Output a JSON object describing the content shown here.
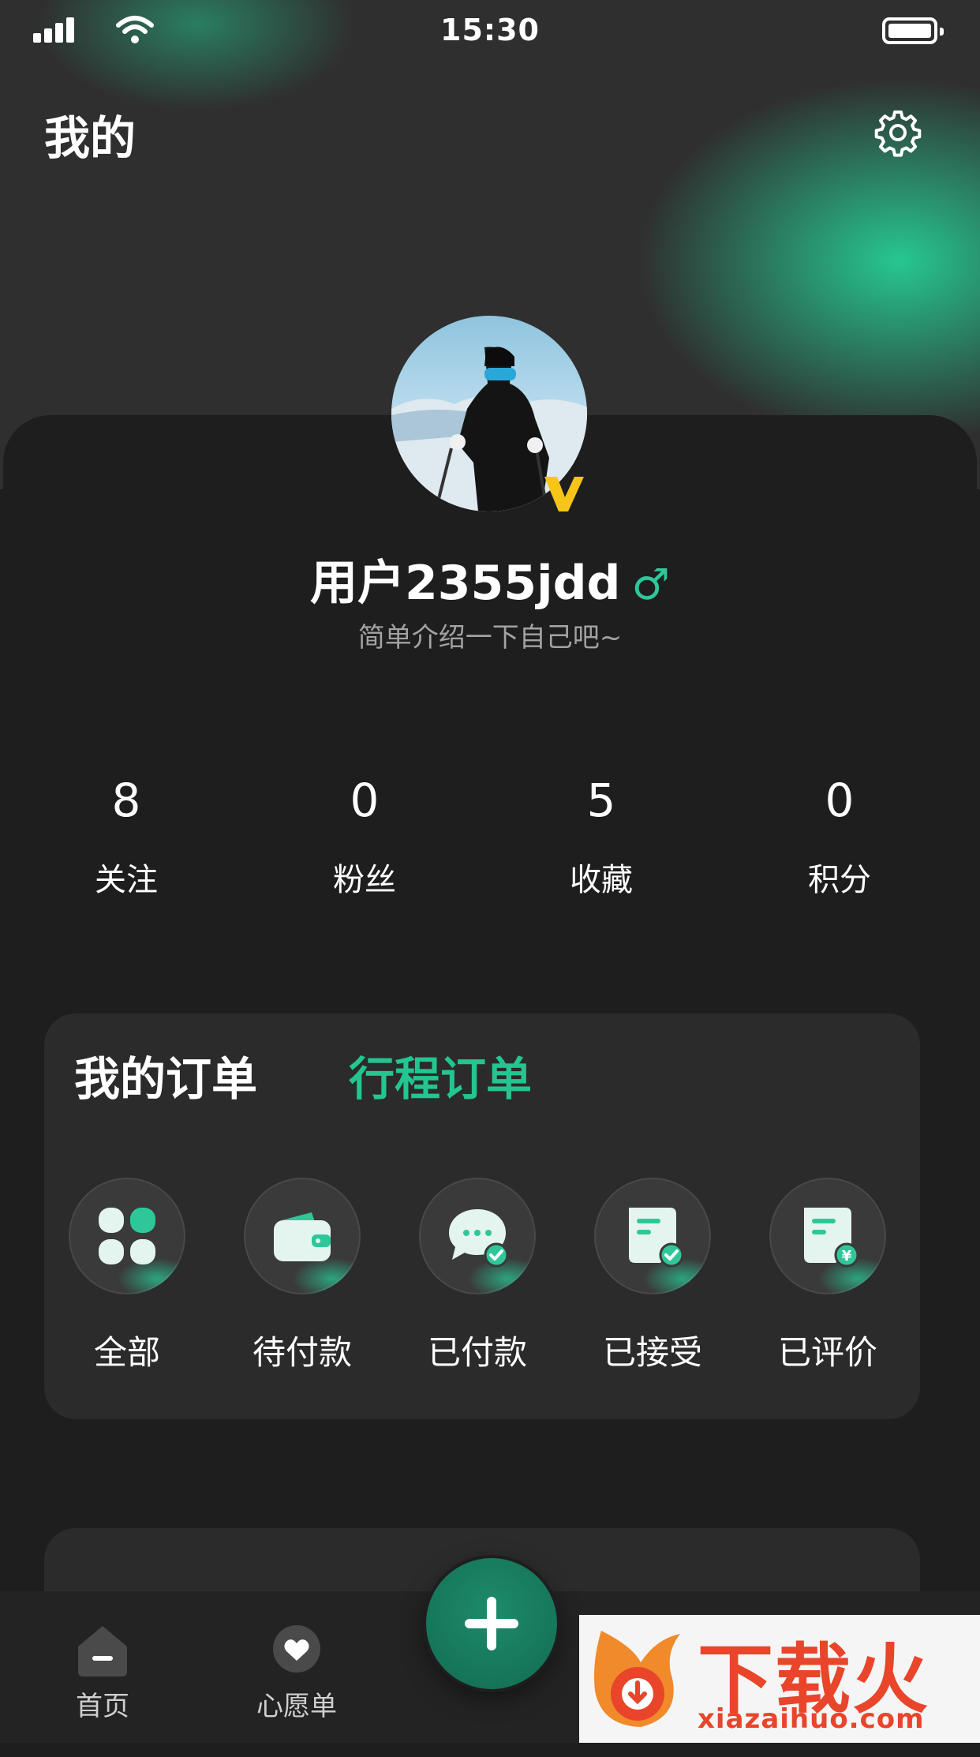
{
  "status_bar": {
    "time": "15:30"
  },
  "header": {
    "title": "我的"
  },
  "profile": {
    "username": "用户2355jdd",
    "gender_symbol": "♂",
    "bio": "简单介绍一下自己吧~"
  },
  "stats": [
    {
      "value": "8",
      "label": "关注"
    },
    {
      "value": "0",
      "label": "粉丝"
    },
    {
      "value": "5",
      "label": "收藏"
    },
    {
      "value": "0",
      "label": "积分"
    }
  ],
  "orders": {
    "tabs": [
      "我的订单",
      "行程订单"
    ],
    "active_tab": "行程订单",
    "items": [
      {
        "label": "全部",
        "icon": "grid-icon"
      },
      {
        "label": "待付款",
        "icon": "wallet-icon"
      },
      {
        "label": "已付款",
        "icon": "chat-check-icon"
      },
      {
        "label": "已接受",
        "icon": "document-check-icon"
      },
      {
        "label": "已评价",
        "icon": "document-yen-icon"
      }
    ]
  },
  "tabbar": {
    "items": [
      {
        "label": "首页",
        "icon": "home-icon"
      },
      {
        "label": "心愿单",
        "icon": "heart-icon"
      }
    ],
    "center_action": "plus-icon"
  },
  "watermark": {
    "brand": "下载火",
    "url": "xiazaihuo.com"
  },
  "colors": {
    "accent": "#23c590",
    "background": "#1e1e1e",
    "card": "#2b2b2b",
    "verified": "#f5c518"
  }
}
